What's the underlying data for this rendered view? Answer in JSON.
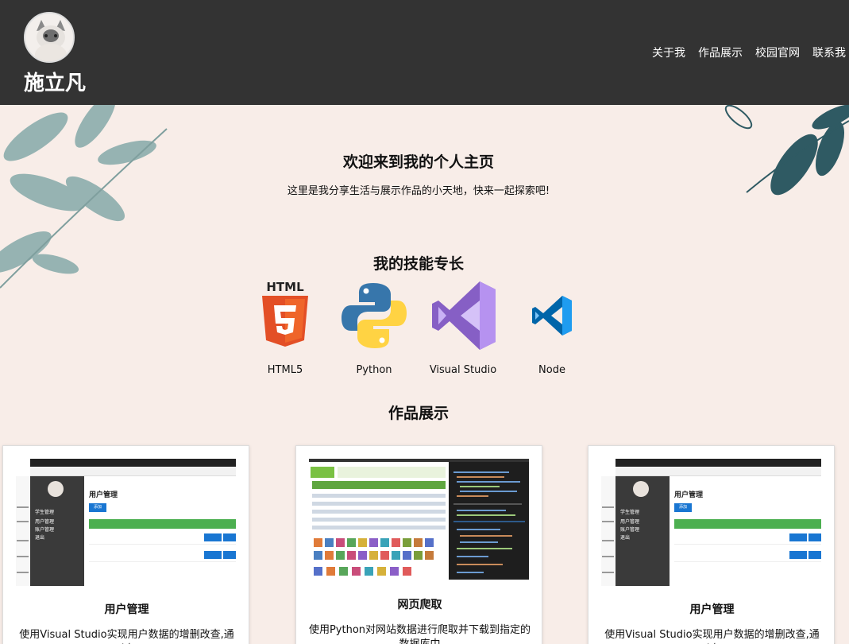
{
  "header": {
    "name": "施立凡",
    "nav": [
      "关于我",
      "作品展示",
      "校园官网",
      "联系我"
    ]
  },
  "welcome": {
    "title": "欢迎来到我的个人主页",
    "subtitle": "这里是我分享生活与展示作品的小天地，快来一起探索吧!"
  },
  "skills": {
    "title": "我的技能专长",
    "items": [
      {
        "label": "HTML5",
        "icon": "html5-icon"
      },
      {
        "label": "Python",
        "icon": "python-icon"
      },
      {
        "label": "Visual Studio",
        "icon": "visual-studio-icon"
      },
      {
        "label": "Node",
        "icon": "vscode-icon"
      }
    ]
  },
  "works": {
    "title": "作品展示",
    "cards": [
      {
        "title": "用户管理",
        "desc": "使用Visual Studio实现用户数据的增删改查,通过"
      },
      {
        "title": "网页爬取",
        "desc": "使用Python对网站数据进行爬取并下载到指定的数据库中"
      },
      {
        "title": "用户管理",
        "desc": "使用Visual Studio实现用户数据的增删改查,通过"
      }
    ]
  },
  "colors": {
    "header_bg": "#333333",
    "page_bg": "#f8ede8",
    "leaf": "#7ea6a8",
    "leaf_dark": "#2f5a63"
  }
}
